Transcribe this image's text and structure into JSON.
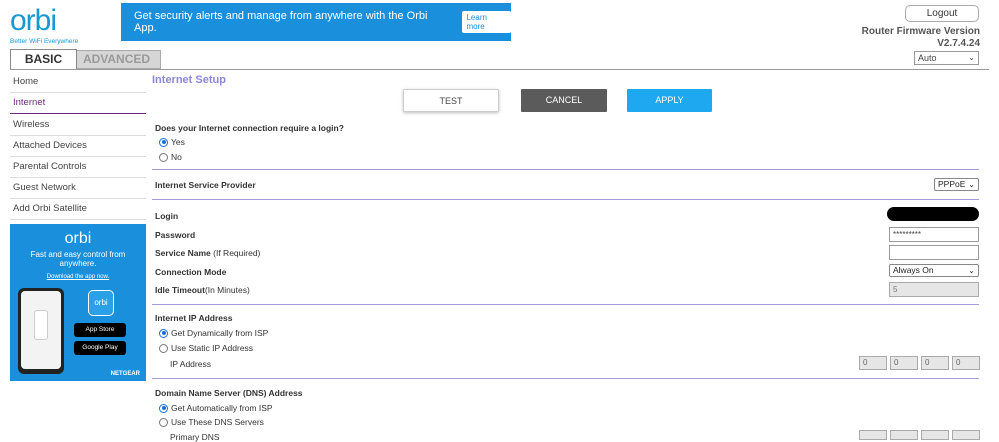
{
  "header": {
    "logo": "orbi",
    "logo_tagline": "Better WiFi Everywhere",
    "banner_text": "Get security alerts and manage from anywhere with the Orbi App.",
    "banner_link": "Learn more",
    "banner_close": "✕",
    "logout_label": "Logout",
    "firmware_label": "Router Firmware Version",
    "firmware_version": "V2.7.4.24",
    "language_selected": "Auto"
  },
  "tabs": {
    "basic": "BASIC",
    "advanced": "ADVANCED"
  },
  "sidebar": {
    "items": [
      {
        "label": "Home"
      },
      {
        "label": "Internet"
      },
      {
        "label": "Wireless"
      },
      {
        "label": "Attached Devices"
      },
      {
        "label": "Parental Controls"
      },
      {
        "label": "Guest Network"
      },
      {
        "label": "Add Orbi Satellite"
      }
    ],
    "active_index": 1
  },
  "promo": {
    "logo": "orbi",
    "line1": "Fast and easy control from",
    "line2": "anywhere.",
    "link": "Download the app now.",
    "app_icon_text": "orbi",
    "app_store": "App Store",
    "google_play": "Google Play",
    "brand": "NETGEAR"
  },
  "main": {
    "title": "Internet Setup",
    "buttons": {
      "test": "TEST",
      "cancel": "CANCEL",
      "apply": "APPLY"
    },
    "login_question": "Does your Internet connection require a login?",
    "login_options": [
      "Yes",
      "No"
    ],
    "login_selected": "Yes",
    "isp_label": "Internet Service Provider",
    "isp_value": "PPPoE",
    "login_label": "Login",
    "password_label": "Password",
    "password_value": "*********",
    "service_name_label": "Service Name",
    "service_name_hint": "(If Required)",
    "service_name_value": "",
    "connection_mode_label": "Connection Mode",
    "connection_mode_value": "Always On",
    "idle_timeout_label": "Idle Timeout",
    "idle_timeout_hint": "(In Minutes)",
    "idle_timeout_value": "5",
    "ip_section_label": "Internet IP Address",
    "ip_options": [
      "Get Dynamically from ISP",
      "Use Static IP Address"
    ],
    "ip_selected": "Get Dynamically from ISP",
    "ip_address_label": "IP Address",
    "ip_octets": [
      "0",
      "0",
      "0",
      "0"
    ],
    "dns_section_label": "Domain Name Server (DNS) Address",
    "dns_options": [
      "Get Automatically from ISP",
      "Use These DNS Servers"
    ],
    "dns_selected": "Get Automatically from ISP",
    "primary_dns_label": "Primary DNS"
  }
}
